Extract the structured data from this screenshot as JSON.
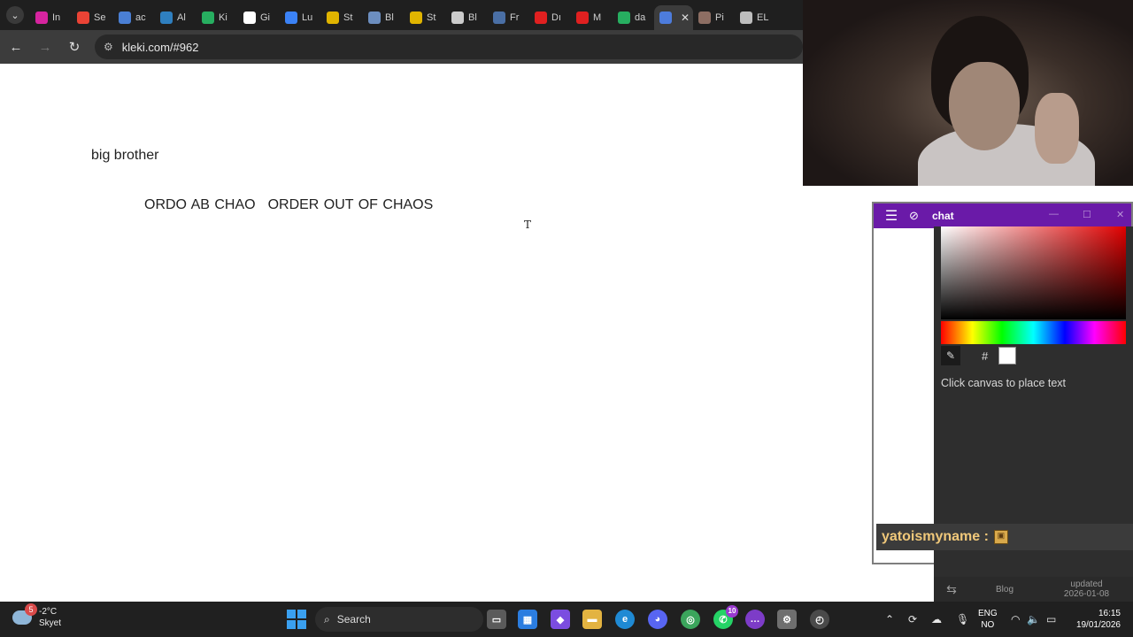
{
  "browser": {
    "tabs": [
      {
        "label": "In",
        "icon": "instagram-icon",
        "color": "#d6249f"
      },
      {
        "label": "Se",
        "icon": "gmail-icon",
        "color": "#ea4335"
      },
      {
        "label": "ac",
        "icon": "search-icon",
        "color": "#4a7fd4"
      },
      {
        "label": "Al",
        "icon": "app-icon",
        "color": "#2f7fbf"
      },
      {
        "label": "Ki",
        "icon": "k-icon",
        "color": "#27ae60"
      },
      {
        "label": "Gi",
        "icon": "gi-icon",
        "color": "#ffffff"
      },
      {
        "label": "Lu",
        "icon": "lu-icon",
        "color": "#3b82f6"
      },
      {
        "label": "St",
        "icon": "crown-icon",
        "color": "#e0b400"
      },
      {
        "label": "Bl",
        "icon": "bl-icon",
        "color": "#6c8ebf"
      },
      {
        "label": "St",
        "icon": "crown-icon",
        "color": "#e0b400"
      },
      {
        "label": "Bl",
        "icon": "openai-icon",
        "color": "#cccccc"
      },
      {
        "label": "Fr",
        "icon": "doc-icon",
        "color": "#4a6fa5"
      },
      {
        "label": "Dı",
        "icon": "youtube-icon",
        "color": "#e02020"
      },
      {
        "label": "M",
        "icon": "youtube-icon",
        "color": "#e02020"
      },
      {
        "label": "da",
        "icon": "k-icon",
        "color": "#27ae60"
      },
      {
        "label": "",
        "icon": "kleki-icon",
        "color": "#4d7cdc",
        "active": true
      },
      {
        "label": "Pi",
        "icon": "pi-icon",
        "color": "#8d6e63"
      },
      {
        "label": "EL",
        "icon": "el-icon",
        "color": "#bdbdbd"
      }
    ],
    "close_symbol": "✕",
    "url": "kleki.com/#962"
  },
  "canvas": {
    "line1": "big brother",
    "line2a": "ORDO AB CHAO",
    "line2b": "ORDER OUT OF CHAOS",
    "cursor": "T"
  },
  "chat": {
    "title": "chat",
    "message_user": "yatoismyname :",
    "colors": {
      "titlebar": "#6a1aa8",
      "username": "#f0c87a"
    }
  },
  "kleki": {
    "hash": "#",
    "hint": "Click canvas to place text",
    "footer_blog": "Blog",
    "footer_updated": "updated",
    "footer_date": "2026-01-08"
  },
  "taskbar": {
    "weather_temp": "-2°C",
    "weather_desc": "Skyet",
    "weather_badge": "5",
    "search_label": "Search",
    "whatsapp_badge": "10",
    "lang_1": "ENG",
    "lang_2": "NO",
    "time": "16:15",
    "date": "19/01/2026"
  }
}
